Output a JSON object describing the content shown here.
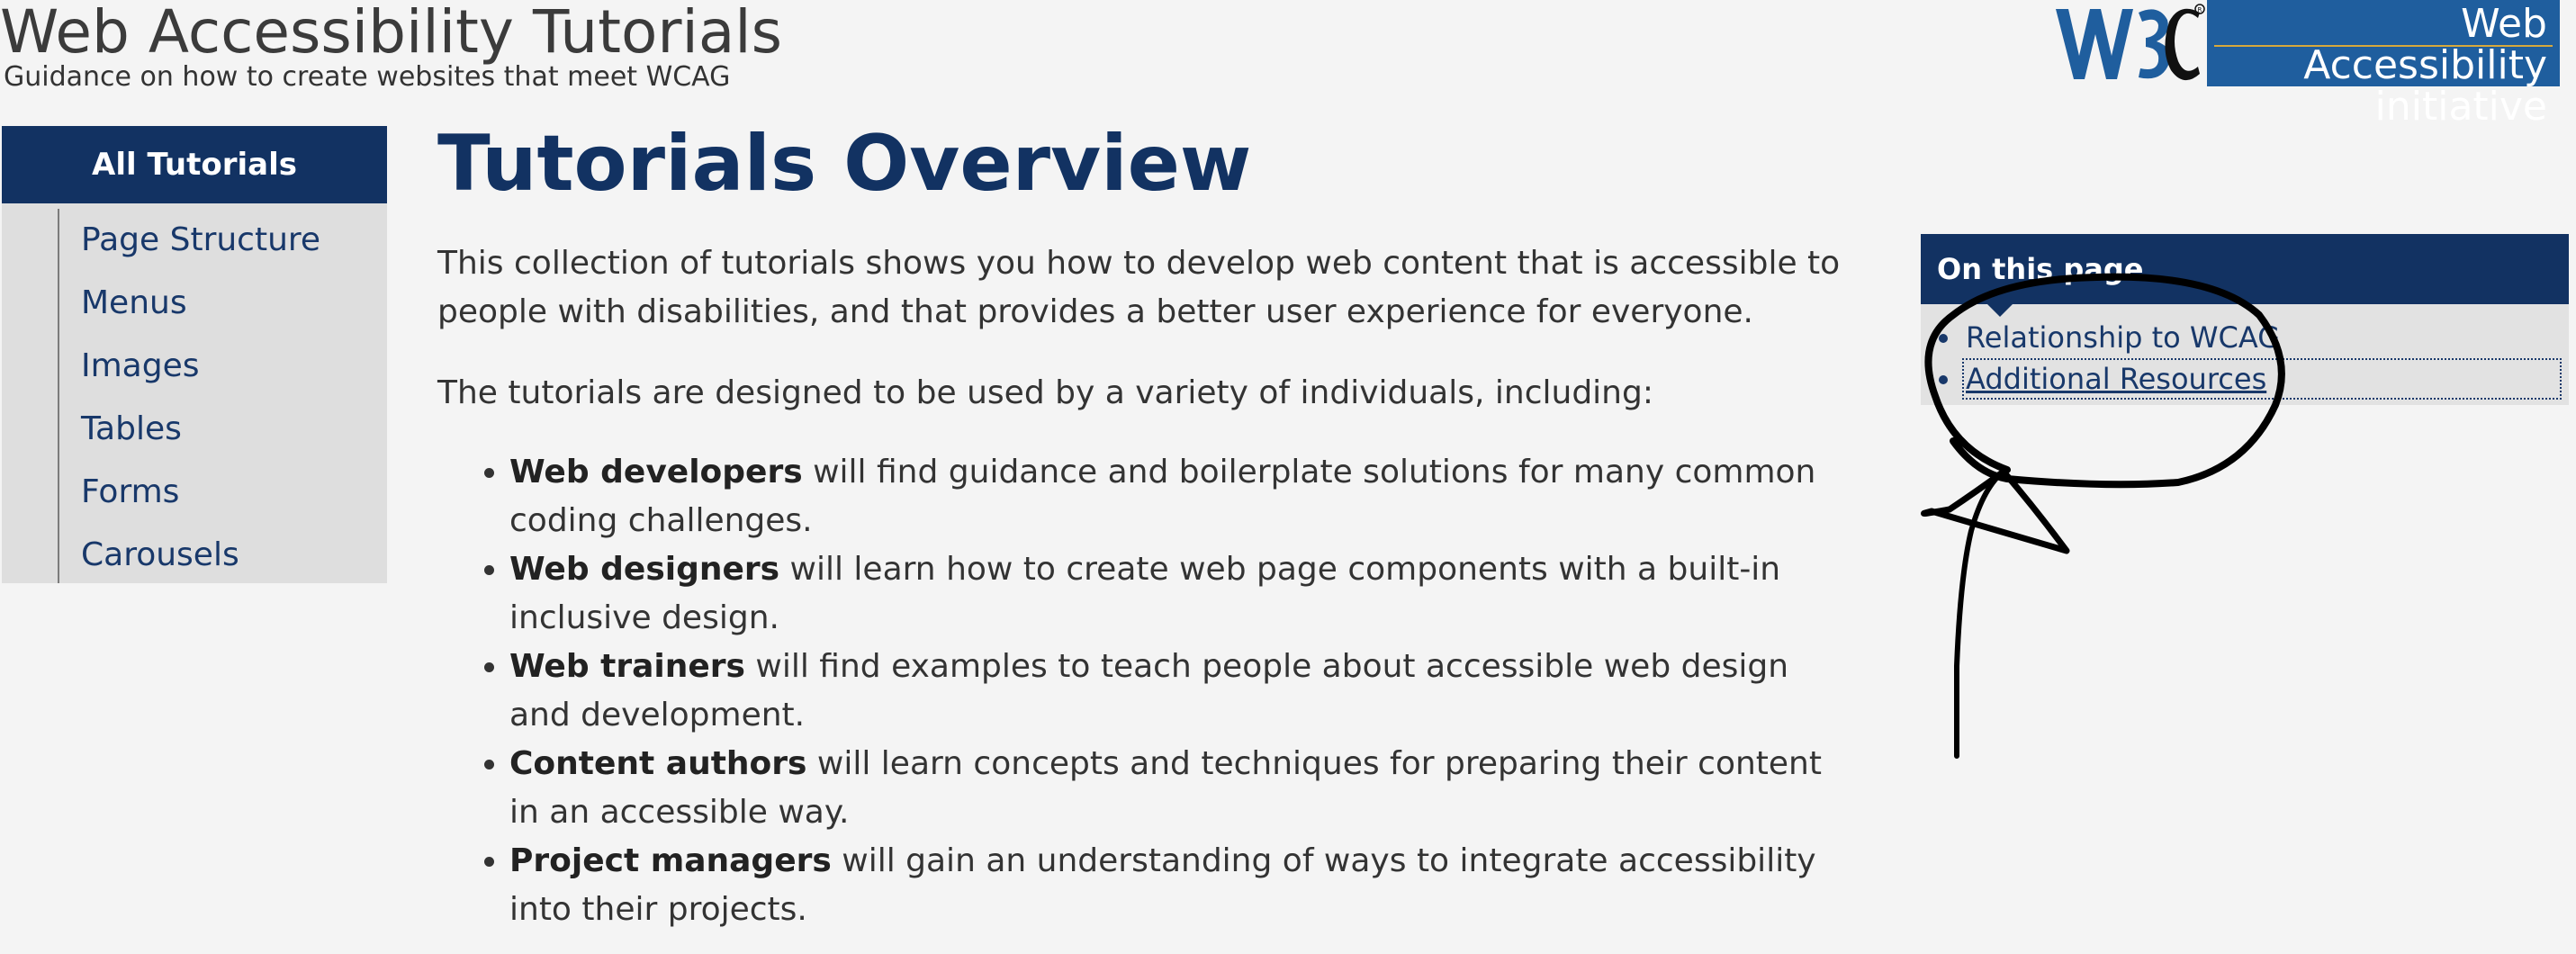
{
  "header": {
    "title": "Web Accessibility Tutorials",
    "subtitle": "Guidance on how to create websites that meet WCAG",
    "wai_logo_line1": "Web Accessibility",
    "wai_logo_line2": "initiative"
  },
  "sidebar": {
    "heading": "All Tutorials",
    "items": [
      {
        "label": "Page Structure"
      },
      {
        "label": "Menus"
      },
      {
        "label": "Images"
      },
      {
        "label": "Tables"
      },
      {
        "label": "Forms"
      },
      {
        "label": "Carousels"
      }
    ]
  },
  "main": {
    "title": "Tutorials Overview",
    "intro1": "This collection of tutorials shows you how to develop web content that is accessible to people with disabilities, and that provides a better user experience for everyone.",
    "intro2": "The tutorials are designed to be used by a variety of individuals, including:",
    "audiences": [
      {
        "bold": "Web developers",
        "text": " will find guidance and boilerplate solutions for many common coding challenges."
      },
      {
        "bold": "Web designers",
        "text": " will learn how to create web page components with a built-in inclusive design."
      },
      {
        "bold": "Web trainers",
        "text": " will find examples to teach people about accessible web design and development."
      },
      {
        "bold": "Content authors",
        "text": " will learn concepts and techniques for preparing their content in an accessible way."
      },
      {
        "bold": "Project managers",
        "text": " will gain an understanding of ways to integrate accessibility into their projects."
      }
    ]
  },
  "toc": {
    "heading": "On this page",
    "items": [
      {
        "label": "Relationship to WCAG"
      },
      {
        "label": "Additional Resources"
      }
    ]
  },
  "colors": {
    "brand_navy": "#123262",
    "wai_blue": "#1f5e9e",
    "background": "#f4f4f4",
    "sidebar_bg": "#dedede",
    "annotation_ink": "#000000"
  },
  "icons": {
    "w3c_logo": "w3c-logo",
    "annotation": "hand-drawn-circle-arrow"
  }
}
